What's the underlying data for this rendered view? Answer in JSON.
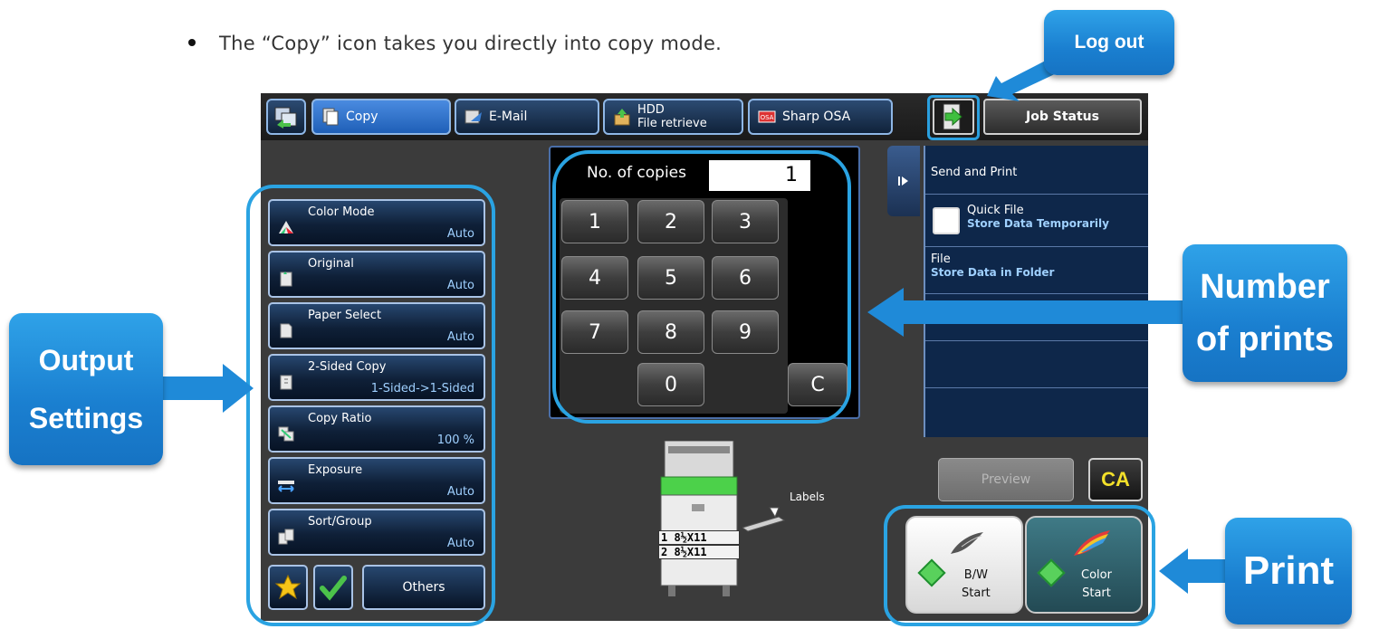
{
  "instruction": {
    "text": "The “Copy” icon takes you directly into copy mode."
  },
  "callouts": {
    "logout": "Log out",
    "output_line1": "Output",
    "output_line2": "Settings",
    "nprints_line1": "Number",
    "nprints_line2": "of prints",
    "print": "Print"
  },
  "tabs": [
    {
      "label": "Copy",
      "active": true
    },
    {
      "label": "E-Mail",
      "active": false
    },
    {
      "label_line1": "HDD",
      "label_line2": "File retrieve",
      "active": false
    },
    {
      "label": "Sharp OSA",
      "active": false
    }
  ],
  "job_status": "Job Status",
  "settings": [
    {
      "label": "Color Mode",
      "value": "Auto",
      "icon": "color-mode-icon"
    },
    {
      "label": "Original",
      "value": "Auto",
      "icon": "original-icon"
    },
    {
      "label": "Paper Select",
      "value": "Auto",
      "icon": "paper-select-icon"
    },
    {
      "label": "2-Sided Copy",
      "value": "1-Sided->1-Sided",
      "icon": "duplex-icon"
    },
    {
      "label": "Copy Ratio",
      "value": "100 %",
      "icon": "copy-ratio-icon"
    },
    {
      "label": "Exposure",
      "value": "Auto",
      "icon": "exposure-icon"
    },
    {
      "label": "Sort/Group",
      "value": "Auto",
      "icon": "sort-group-icon"
    }
  ],
  "others": "Others",
  "copies": {
    "label": "No. of copies",
    "value": "1"
  },
  "keys": [
    "1",
    "2",
    "3",
    "4",
    "5",
    "6",
    "7",
    "8",
    "9",
    "0",
    "C"
  ],
  "right_panel": {
    "send_and_print": "Send and Print",
    "quick_file": "Quick File",
    "quick_file_sub": "Store Data Temporarily",
    "file": "File",
    "file_sub": "Store Data in Folder"
  },
  "printer": {
    "labels": "Labels",
    "tray1": "1  8½X11",
    "tray2": "2  8½X11"
  },
  "preview": "Preview",
  "ca": "CA",
  "bw_start": {
    "line1": "B/W",
    "line2": "Start"
  },
  "color_start": {
    "line1": "Color",
    "line2": "Start"
  },
  "colors": {
    "accent": "#2aa3e2",
    "start_green": "#59d15c",
    "ca_yellow": "#f3e02a"
  }
}
